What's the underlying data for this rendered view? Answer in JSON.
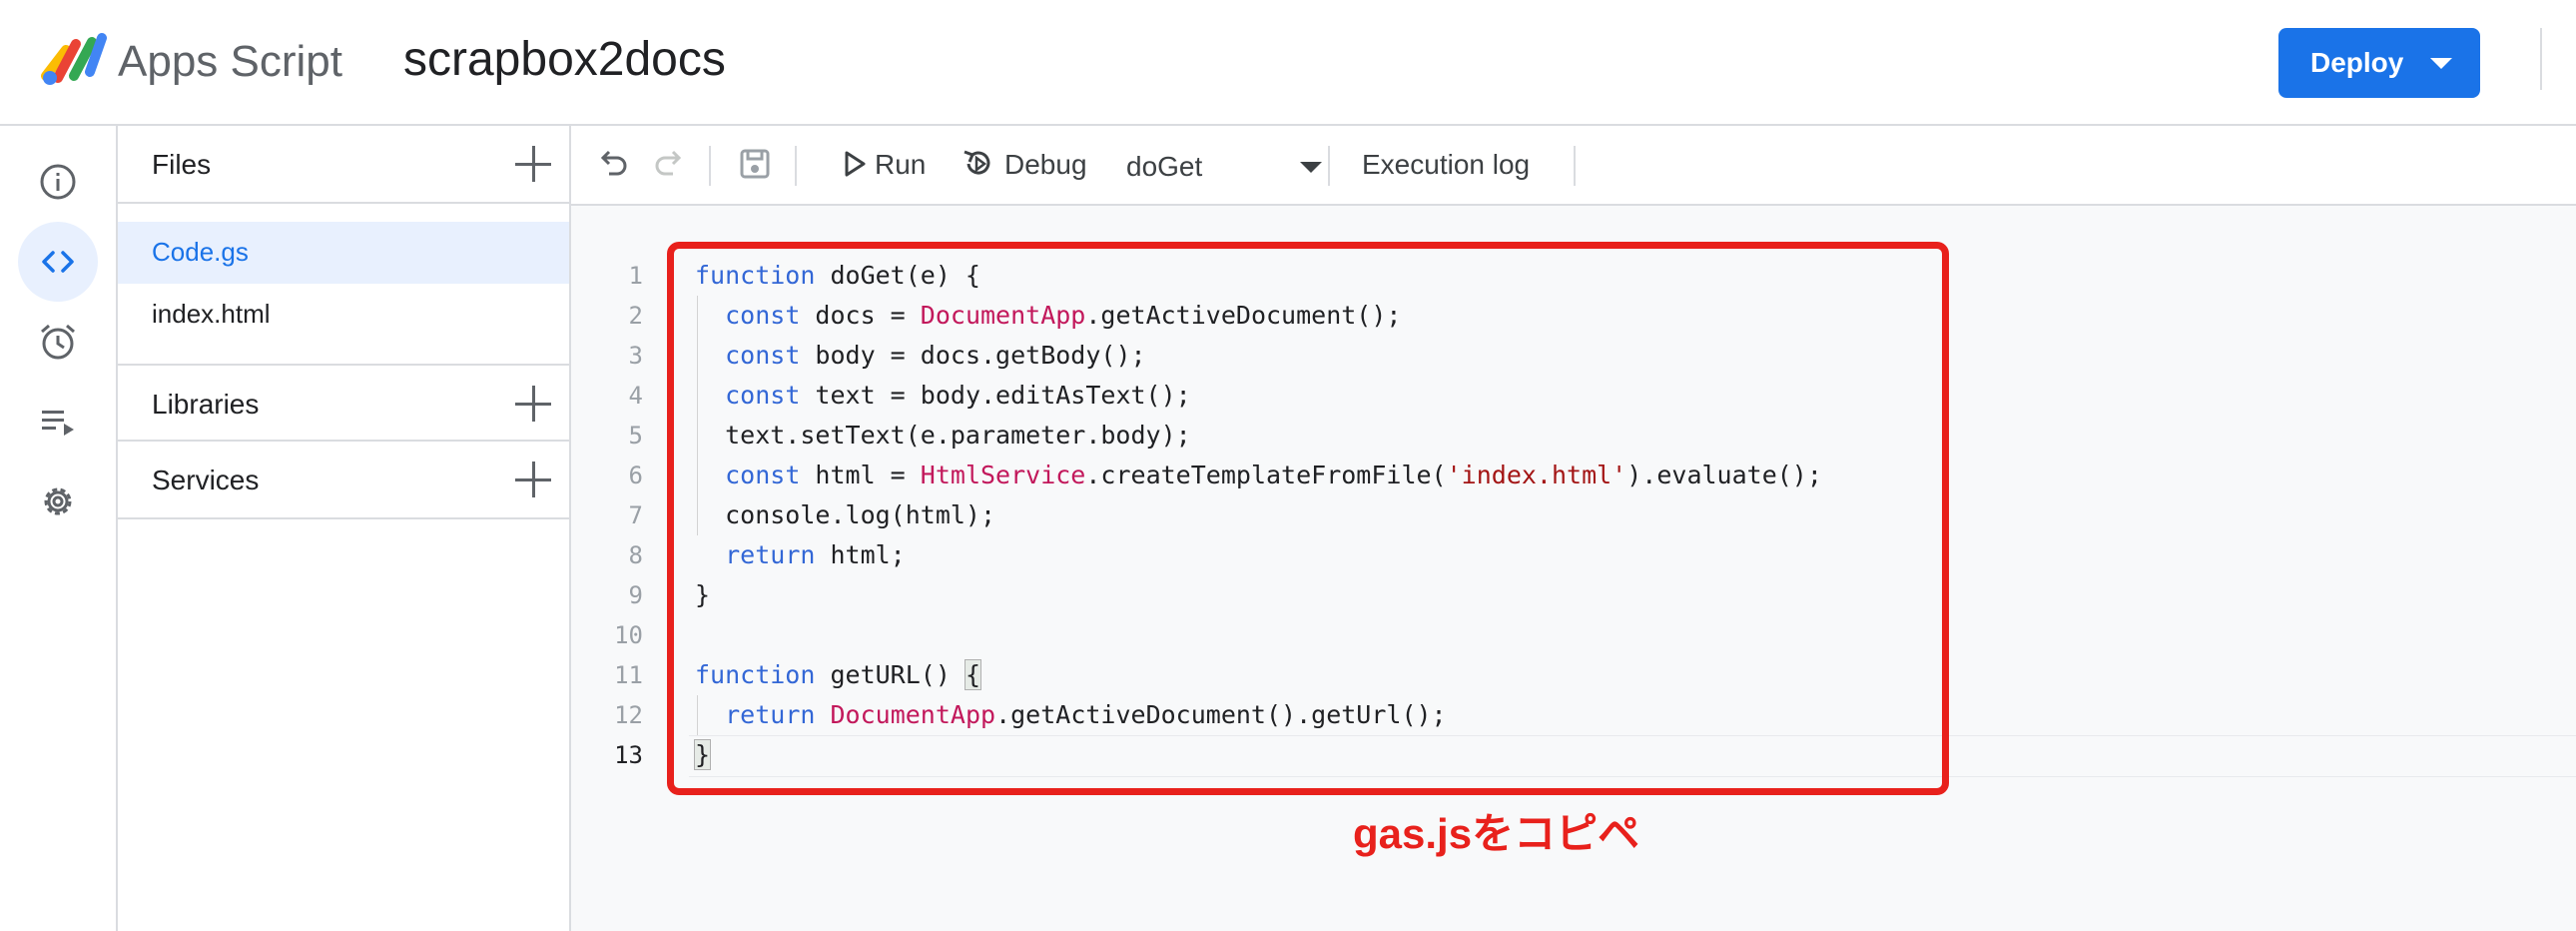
{
  "header": {
    "app_name": "Apps Script",
    "project_name": "scrapbox2docs",
    "deploy_label": "Deploy"
  },
  "rail": {
    "items": [
      {
        "icon": "info-icon",
        "active": false
      },
      {
        "icon": "code-icon",
        "active": true
      },
      {
        "icon": "alarm-clock-icon",
        "active": false
      },
      {
        "icon": "executions-list-icon",
        "active": false
      },
      {
        "icon": "gear-icon",
        "active": false
      }
    ]
  },
  "files_panel": {
    "files_title": "Files",
    "files": [
      "Code.gs",
      "index.html"
    ],
    "active_file": "Code.gs",
    "libraries_title": "Libraries",
    "services_title": "Services"
  },
  "toolbar": {
    "run_label": "Run",
    "debug_label": "Debug",
    "function_selected": "doGet",
    "execution_log_label": "Execution log"
  },
  "editor": {
    "line_numbers": [
      "1",
      "2",
      "3",
      "4",
      "5",
      "6",
      "7",
      "8",
      "9",
      "10",
      "11",
      "12",
      "13"
    ],
    "current_line": "13"
  },
  "annotation": {
    "text": "gas.jsをコピペ",
    "color": "#e8211c"
  },
  "colors": {
    "accent": "#1a73e8",
    "keyword": "#3367d6",
    "class_name": "#c2185b",
    "string": "#a31515"
  }
}
